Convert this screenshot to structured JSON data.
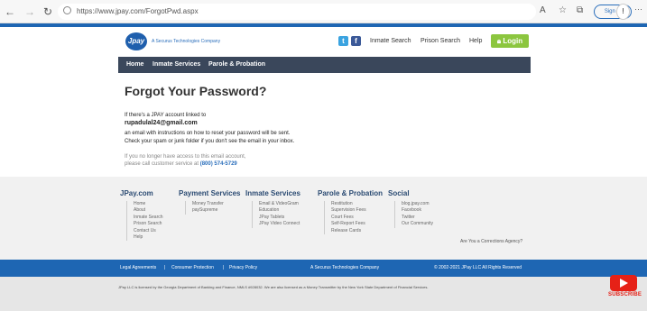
{
  "browser": {
    "url": "https://www.jpay.com/ForgotPwd.aspx",
    "signin_label": "Sign in"
  },
  "header": {
    "logo_text": "Jpay",
    "tagline": "A Securus Technologies Company",
    "links": [
      "Inmate Search",
      "Prison Search",
      "Help"
    ],
    "login_label": "Login"
  },
  "nav": [
    "Home",
    "Inmate Services",
    "Parole & Probation"
  ],
  "main": {
    "title": "Forgot Your Password?",
    "line1": "If there's a JPAY account linked to",
    "email": "rupadulal24@gmail.com",
    "line2": "an email with instructions on how to reset your password will be sent.",
    "line3": "Check your spam or junk folder if you don't see the email in your inbox.",
    "muted1": "If you no longer have access to this email account,",
    "muted2": "please call customer service at",
    "phone": "(800) 574-5729"
  },
  "footer": {
    "columns": [
      {
        "title": "JPay.com",
        "items": [
          "Home",
          "About",
          "Inmate Search",
          "Prison Search",
          "Contact Us",
          "Help"
        ]
      },
      {
        "title": "Payment Services",
        "items": [
          "Money Transfer",
          "paySupreme"
        ]
      },
      {
        "title": "Inmate Services",
        "items": [
          "Email & VideoGram",
          "Education",
          "JPay Tablets",
          "JPay Video Connect"
        ]
      },
      {
        "title": "Parole & Probation",
        "items": [
          "Restitution",
          "Supervision Fees",
          "Court Fees",
          "Self-Report Fees",
          "Release Cards"
        ]
      },
      {
        "title": "Social",
        "items": [
          "blog.jpay.com",
          "Facebook",
          "Twitter",
          "Our Community"
        ]
      }
    ],
    "corrections": "Are You a Corrections Agency?"
  },
  "bottom_bar": {
    "legal": "Legal Agreements",
    "consumer": "Consumer Protection",
    "privacy": "Privacy Policy",
    "company": "A Securus Technologies Company",
    "copyright": "© 2002-2021 JPay LLC All Rights Reserved",
    "license": "JPay LLC is licensed by the Georgia Department of Banking and Finance, NMLS #928032.  We are also licensed as a Money Transmitter by the New York State Department of Financial Services."
  },
  "overlay": {
    "subscribe": "SUBSCRIBE"
  }
}
